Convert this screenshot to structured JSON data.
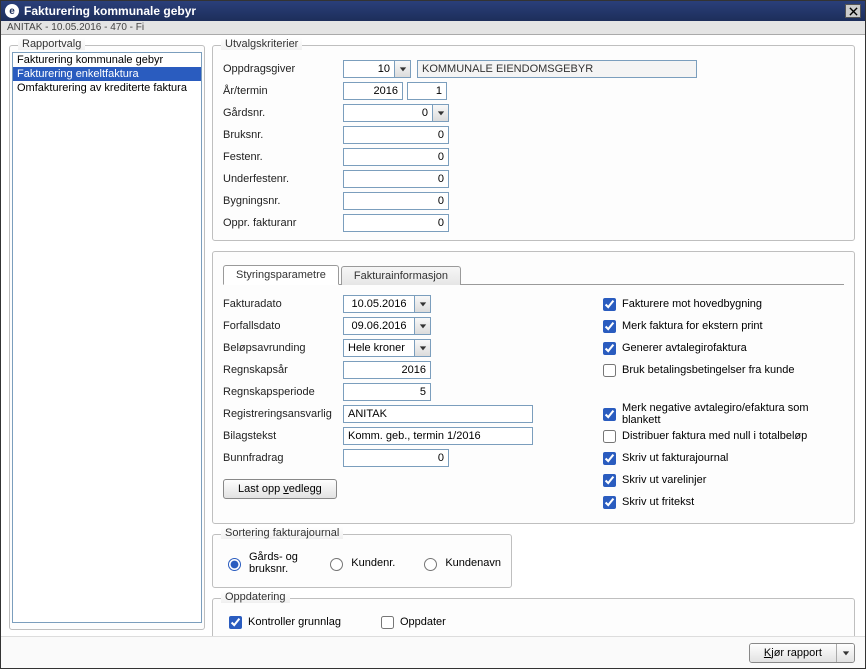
{
  "window": {
    "title": "Fakturering kommunale gebyr",
    "subtitle": "ANITAK - 10.05.2016 - 470 - Fi"
  },
  "sidebar": {
    "legend": "Rapportvalg",
    "items": [
      {
        "label": "Fakturering kommunale gebyr"
      },
      {
        "label": "Fakturering enkeltfaktura"
      },
      {
        "label": "Omfakturering av krediterte faktura"
      }
    ]
  },
  "criteria": {
    "legend": "Utvalgskriterier",
    "oppdragsgiver_label": "Oppdragsgiver",
    "oppdragsgiver_value": "10",
    "oppdragsgiver_text": "KOMMUNALE EIENDOMSGEBYR",
    "artermin_label": "År/termin",
    "ar_value": "2016",
    "termin_value": "1",
    "gardsnr_label": "Gårdsnr.",
    "gardsnr_value": "0",
    "bruksnr_label": "Bruksnr.",
    "bruksnr_value": "0",
    "festenr_label": "Festenr.",
    "festenr_value": "0",
    "underfestenr_label": "Underfestenr.",
    "underfestenr_value": "0",
    "bygningsnr_label": "Bygningsnr.",
    "bygningsnr_value": "0",
    "opprfakturanr_label": "Oppr. fakturanr",
    "opprfakturanr_value": "0"
  },
  "tabs": {
    "styring": "Styringsparametre",
    "fakturainfo": "Fakturainformasjon"
  },
  "params": {
    "fakturadato_label": "Fakturadato",
    "fakturadato_value": "10.05.2016",
    "forfallsdato_label": "Forfallsdato",
    "forfallsdato_value": "09.06.2016",
    "belopsavrunding_label": "Beløpsavrunding",
    "belopsavrunding_value": "Hele kroner",
    "regnskapsar_label": "Regnskapsår",
    "regnskapsar_value": "2016",
    "regnskapsperiode_label": "Regnskapsperiode",
    "regnskapsperiode_value": "5",
    "registreringsansvarlig_label": "Registreringsansvarlig",
    "registreringsansvarlig_value": "ANITAK",
    "bilagstekst_label": "Bilagstekst",
    "bilagstekst_value": "Komm. geb., termin 1/2016",
    "bunnfradrag_label": "Bunnfradrag",
    "bunnfradrag_value": "0",
    "upload_label": "Last opp vedlegg"
  },
  "checks": {
    "hovedbygning": "Fakturere mot hovedbygning",
    "ekstern_print": "Merk faktura for ekstern print",
    "avtalegiro": "Generer avtalegirofaktura",
    "betalingsbetingelser": "Bruk betalingsbetingelser fra kunde",
    "negative_blankett": "Merk negative avtalegiro/efaktura som blankett",
    "distribuer_null": "Distribuer faktura med null i totalbeløp",
    "fakturajournal": "Skriv ut fakturajournal",
    "varelinjer": "Skriv ut varelinjer",
    "fritekst": "Skriv ut fritekst"
  },
  "sorting": {
    "legend": "Sortering fakturajournal",
    "opt1": "Gårds- og bruksnr.",
    "opt2": "Kundenr.",
    "opt3": "Kundenavn"
  },
  "oppdatering": {
    "legend": "Oppdatering",
    "kontroller": "Kontroller grunnlag",
    "oppdater": "Oppdater"
  },
  "footer": {
    "run": "Kjør rapport"
  }
}
